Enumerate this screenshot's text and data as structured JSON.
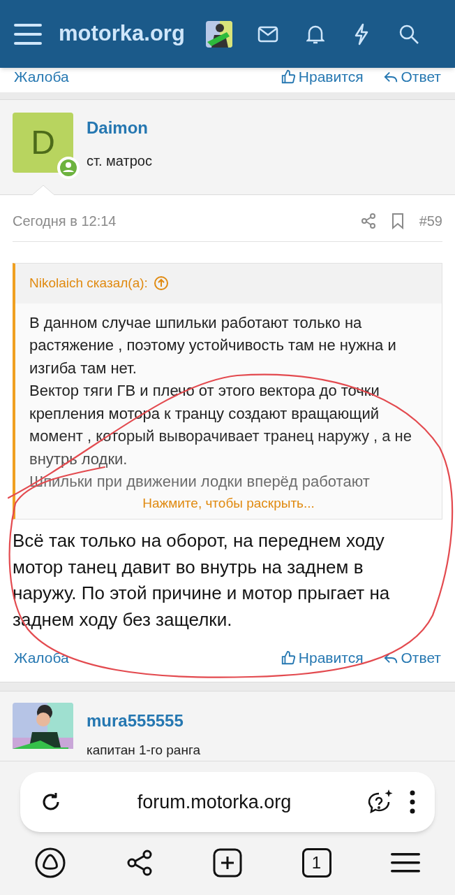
{
  "top_bar": {
    "logo": "motorka.org"
  },
  "previous_post_actions": {
    "report": "Жалоба",
    "like": "Нравится",
    "reply": "Ответ"
  },
  "post": {
    "avatar_letter": "D",
    "author": "Daimon",
    "rank": "ст. матрос",
    "online": true,
    "time": "Сегодня в 12:14",
    "number": "#59",
    "quote": {
      "author_line": "Nikolaich сказал(а):",
      "paragraphs": [
        "В данном случае шпильки работают только на растяжение , поэтому устойчивость там не нужна и изгиба там нет.",
        "Вектор тяги ГВ и плечо от этого вектора до точки крепления мотора к транцу создают вращающий момент , который выворачивает транец наружу , а не внутрь лодки.",
        "Шпильки при движении лодки вперёд работают"
      ],
      "expand": "Нажмите, чтобы раскрыть..."
    },
    "body": "Всё так только на оборот, на переднем ходу мотор танец давит во внутрь на заднем в наружу. По этой причине и мотор прыгает на заднем ходу без защелки.",
    "actions": {
      "report": "Жалоба",
      "like": "Нравится",
      "reply": "Ответ"
    }
  },
  "next_post": {
    "author": "mura555555",
    "rank": "капитан 1-го ранга"
  },
  "browser": {
    "url": "forum.motorka.org",
    "tab_count": "1"
  }
}
